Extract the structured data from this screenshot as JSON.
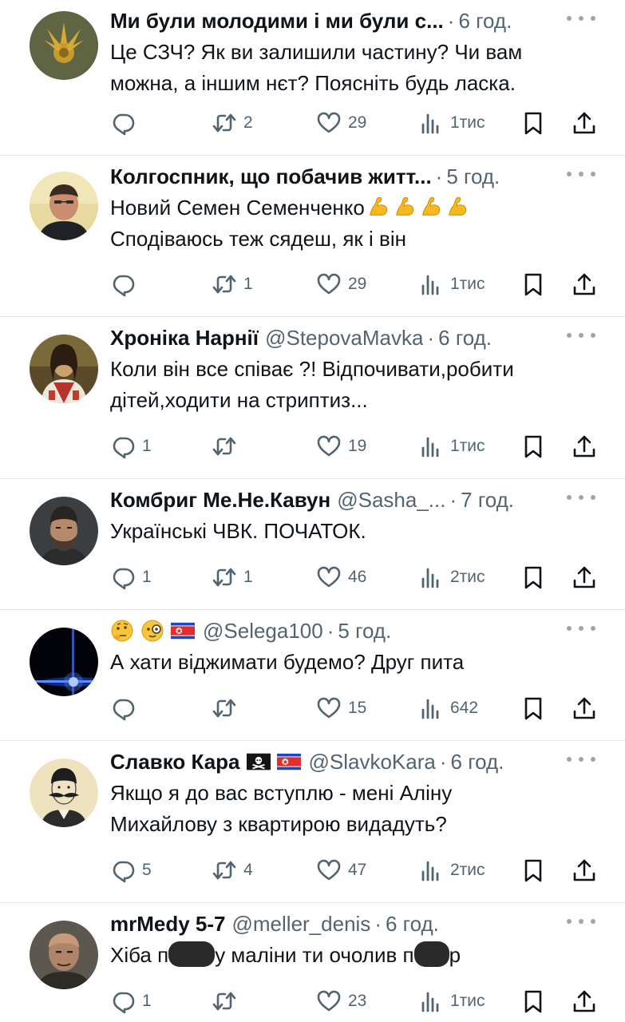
{
  "tweets": [
    {
      "name": "Ми були молодими і ми були с...",
      "handle": "",
      "time": "6 год.",
      "lines": [
        "Це СЗЧ? Як ви залишили частину? Чи вам",
        "можна, а іншим нєт? Поясніть будь ласка."
      ],
      "replies": "",
      "retweets": "2",
      "likes": "29",
      "views": "1тис",
      "avatar": "emblem-avatar"
    },
    {
      "name": "Колгоспник, що побачив житт...",
      "handle": "",
      "time": "5 год.",
      "lines": [
        "Новий Семен Семенченко",
        "Сподіваюсь теж сядеш, як і він"
      ],
      "line_emoji": "flexed-biceps-emoji x4",
      "replies": "",
      "retweets": "1",
      "likes": "29",
      "views": "1тис",
      "avatar": "man-portrait-avatar"
    },
    {
      "name": "Хроніка Нарнії",
      "handle": "@StepovaMavka",
      "time": "6 год.",
      "lines": [
        "Коли він все співає ?!  Відпочивати,робити",
        "дітей,ходити на стриптиз..."
      ],
      "replies": "1",
      "retweets": "",
      "likes": "19",
      "views": "1тис",
      "avatar": "mona-lisa-avatar"
    },
    {
      "name": "Комбриг Ме.Не.Кавун",
      "handle": "@Sasha_...",
      "time": "7 год.",
      "lines": [
        "Українські ЧВК. ПОЧАТОК."
      ],
      "replies": "1",
      "retweets": "1",
      "likes": "46",
      "views": "2тис",
      "avatar": "bearded-man-avatar"
    },
    {
      "name": "",
      "handle": "@Selega100",
      "time": "5 год.",
      "lines": [
        "А хати віджимати будемо? Друг пита"
      ],
      "name_emoji": "thinking-face, monocle-face, north-korea-flag",
      "replies": "",
      "retweets": "",
      "likes": "15",
      "views": "642",
      "avatar": "blue-star-avatar"
    },
    {
      "name": "Славко Кара",
      "handle": "@SlavkoKara",
      "time": "6 год.",
      "lines": [
        "Якщо я до вас вступлю - мені Аліну",
        "Михайлову з квартирою видадуть?"
      ],
      "name_emoji": "pirate-flag, north-korea-flag",
      "replies": "5",
      "retweets": "4",
      "likes": "47",
      "views": "2тис",
      "avatar": "engraving-portrait-avatar"
    },
    {
      "name": "mrMedy 5-7",
      "handle": "@meller_denis",
      "time": "6 год.",
      "text_parts": [
        "Хіба п",
        "у маліни ти очолив п",
        "р"
      ],
      "replies": "1",
      "retweets": "",
      "likes": "23",
      "views": "1тис",
      "avatar": "bald-man-avatar"
    }
  ],
  "icons": [
    "reply-icon",
    "retweet-icon",
    "like-icon",
    "views-icon",
    "bookmark-icon",
    "share-icon",
    "more-icon"
  ],
  "colors": {
    "text": "#0f1419",
    "secondary": "#536471",
    "divider": "#e6e9ec"
  }
}
